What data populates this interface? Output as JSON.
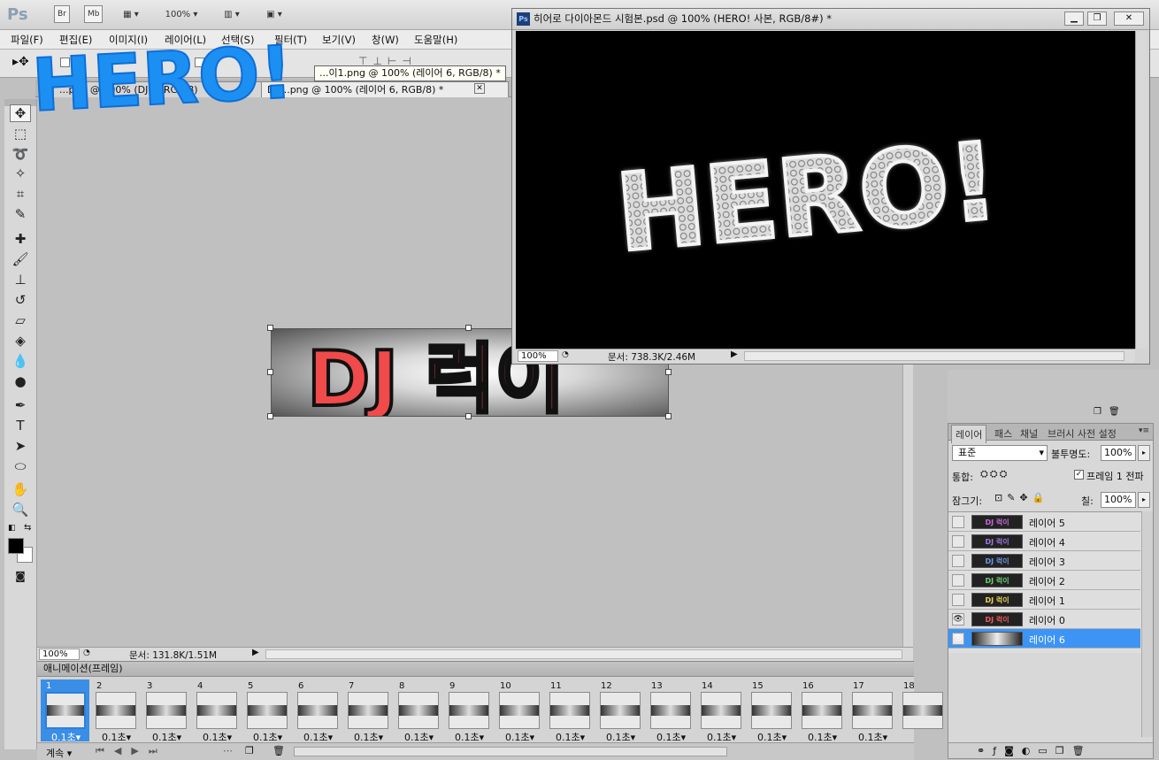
{
  "app": {
    "logo": "Ps",
    "bridge": "Br",
    "minibridge": "Mb",
    "zoom": "100%"
  },
  "menu": [
    "파일(F)",
    "편집(E)",
    "이미지(I)",
    "레이어(L)",
    "선택(S)",
    "필터(T)",
    "보기(V)",
    "창(W)",
    "도움말(H)"
  ],
  "overlay": {
    "hero_logo": "HERO!"
  },
  "doc_tabs": [
    {
      "label": "...png @ 100% (DJ..., RGB/8)"
    },
    {
      "label": "DJ ...png @ 100% (레이어 6, RGB/8) *"
    }
  ],
  "tooltip": "...이1.png @ 100% (레이어 6, RGB/8) *",
  "main_canvas": {
    "banner_text": "DJ 럭이",
    "zoom": "100%",
    "doc_info": "문서: 131.8K/1.51M"
  },
  "doc_window": {
    "title": "히어로 다이아몬드 시험본.psd @ 100% (HERO! 사본, RGB/8#) *",
    "canvas_text": "HERO!",
    "zoom": "100%",
    "doc_info": "문서: 738.3K/2.46M"
  },
  "animation": {
    "title": "애니메이션(프레임)",
    "frames": [
      {
        "num": "1",
        "delay": "0.1초"
      },
      {
        "num": "2",
        "delay": "0.1초"
      },
      {
        "num": "3",
        "delay": "0.1초"
      },
      {
        "num": "4",
        "delay": "0.1초"
      },
      {
        "num": "5",
        "delay": "0.1초"
      },
      {
        "num": "6",
        "delay": "0.1초"
      },
      {
        "num": "7",
        "delay": "0.1초"
      },
      {
        "num": "8",
        "delay": "0.1초"
      },
      {
        "num": "9",
        "delay": "0.1초"
      },
      {
        "num": "10",
        "delay": "0.1초"
      },
      {
        "num": "11",
        "delay": "0.1초"
      },
      {
        "num": "12",
        "delay": "0.1초"
      },
      {
        "num": "13",
        "delay": "0.1초"
      },
      {
        "num": "14",
        "delay": "0.1초"
      },
      {
        "num": "15",
        "delay": "0.1초"
      },
      {
        "num": "16",
        "delay": "0.1초"
      },
      {
        "num": "17",
        "delay": "0.1초"
      },
      {
        "num": "18",
        "delay": ""
      }
    ],
    "loop": "계속"
  },
  "layers_panel": {
    "tabs": [
      "레이어",
      "패스",
      "채널",
      "브러시 사전 설정"
    ],
    "blend_mode": "표준",
    "opacity_label": "불투명도:",
    "opacity": "100%",
    "unify_label": "통합:",
    "propagate": "프레임 1 전파",
    "lock_label": "잠그기:",
    "fill_label": "칠:",
    "fill": "100%",
    "layers": [
      {
        "name": "레이어 5",
        "thumb": "DJ 럭이",
        "visible": false,
        "color": "#c86ad8"
      },
      {
        "name": "레이어 4",
        "thumb": "DJ 럭이",
        "visible": false,
        "color": "#9b7ae0"
      },
      {
        "name": "레이어 3",
        "thumb": "DJ 럭이",
        "visible": false,
        "color": "#6f96e6"
      },
      {
        "name": "레이어 2",
        "thumb": "DJ 럭이",
        "visible": false,
        "color": "#6ed06e"
      },
      {
        "name": "레이어 1",
        "thumb": "DJ 럭이",
        "visible": false,
        "color": "#e6d45a"
      },
      {
        "name": "레이어 0",
        "thumb": "DJ 럭이",
        "visible": true,
        "color": "#ef5a5a"
      },
      {
        "name": "레이어 6",
        "thumb": "",
        "visible": true,
        "color": "#cccccc",
        "selected": true
      }
    ]
  }
}
